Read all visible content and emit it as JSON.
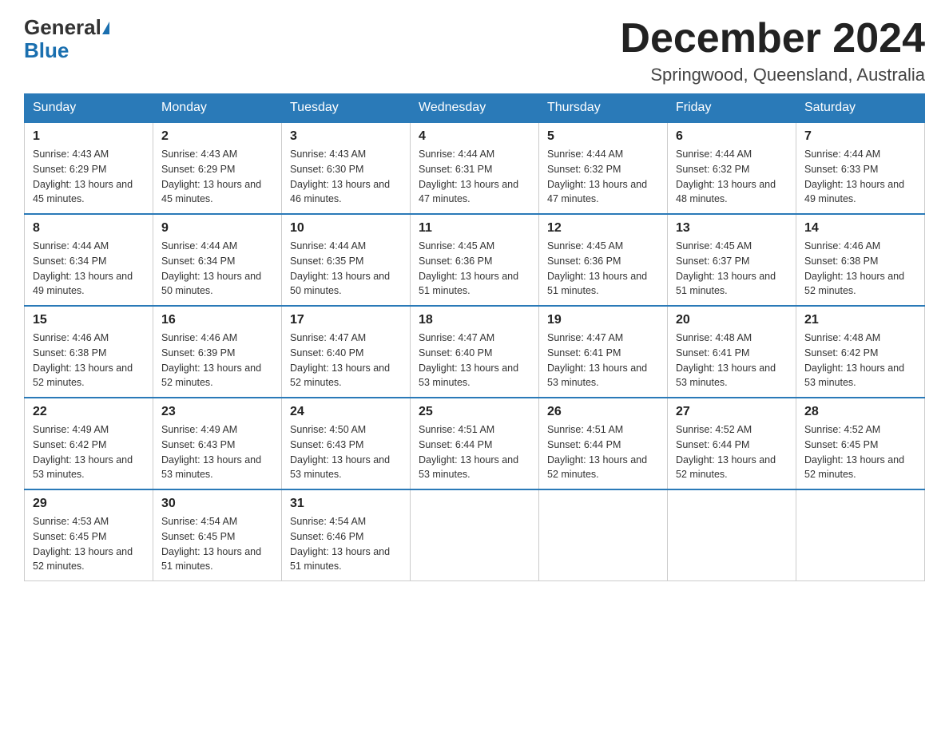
{
  "logo": {
    "line1": "General",
    "triangle": "▶",
    "line2": "Blue"
  },
  "title": "December 2024",
  "subtitle": "Springwood, Queensland, Australia",
  "days_of_week": [
    "Sunday",
    "Monday",
    "Tuesday",
    "Wednesday",
    "Thursday",
    "Friday",
    "Saturday"
  ],
  "weeks": [
    [
      {
        "day": "1",
        "sunrise": "4:43 AM",
        "sunset": "6:29 PM",
        "daylight": "13 hours and 45 minutes."
      },
      {
        "day": "2",
        "sunrise": "4:43 AM",
        "sunset": "6:29 PM",
        "daylight": "13 hours and 45 minutes."
      },
      {
        "day": "3",
        "sunrise": "4:43 AM",
        "sunset": "6:30 PM",
        "daylight": "13 hours and 46 minutes."
      },
      {
        "day": "4",
        "sunrise": "4:44 AM",
        "sunset": "6:31 PM",
        "daylight": "13 hours and 47 minutes."
      },
      {
        "day": "5",
        "sunrise": "4:44 AM",
        "sunset": "6:32 PM",
        "daylight": "13 hours and 47 minutes."
      },
      {
        "day": "6",
        "sunrise": "4:44 AM",
        "sunset": "6:32 PM",
        "daylight": "13 hours and 48 minutes."
      },
      {
        "day": "7",
        "sunrise": "4:44 AM",
        "sunset": "6:33 PM",
        "daylight": "13 hours and 49 minutes."
      }
    ],
    [
      {
        "day": "8",
        "sunrise": "4:44 AM",
        "sunset": "6:34 PM",
        "daylight": "13 hours and 49 minutes."
      },
      {
        "day": "9",
        "sunrise": "4:44 AM",
        "sunset": "6:34 PM",
        "daylight": "13 hours and 50 minutes."
      },
      {
        "day": "10",
        "sunrise": "4:44 AM",
        "sunset": "6:35 PM",
        "daylight": "13 hours and 50 minutes."
      },
      {
        "day": "11",
        "sunrise": "4:45 AM",
        "sunset": "6:36 PM",
        "daylight": "13 hours and 51 minutes."
      },
      {
        "day": "12",
        "sunrise": "4:45 AM",
        "sunset": "6:36 PM",
        "daylight": "13 hours and 51 minutes."
      },
      {
        "day": "13",
        "sunrise": "4:45 AM",
        "sunset": "6:37 PM",
        "daylight": "13 hours and 51 minutes."
      },
      {
        "day": "14",
        "sunrise": "4:46 AM",
        "sunset": "6:38 PM",
        "daylight": "13 hours and 52 minutes."
      }
    ],
    [
      {
        "day": "15",
        "sunrise": "4:46 AM",
        "sunset": "6:38 PM",
        "daylight": "13 hours and 52 minutes."
      },
      {
        "day": "16",
        "sunrise": "4:46 AM",
        "sunset": "6:39 PM",
        "daylight": "13 hours and 52 minutes."
      },
      {
        "day": "17",
        "sunrise": "4:47 AM",
        "sunset": "6:40 PM",
        "daylight": "13 hours and 52 minutes."
      },
      {
        "day": "18",
        "sunrise": "4:47 AM",
        "sunset": "6:40 PM",
        "daylight": "13 hours and 53 minutes."
      },
      {
        "day": "19",
        "sunrise": "4:47 AM",
        "sunset": "6:41 PM",
        "daylight": "13 hours and 53 minutes."
      },
      {
        "day": "20",
        "sunrise": "4:48 AM",
        "sunset": "6:41 PM",
        "daylight": "13 hours and 53 minutes."
      },
      {
        "day": "21",
        "sunrise": "4:48 AM",
        "sunset": "6:42 PM",
        "daylight": "13 hours and 53 minutes."
      }
    ],
    [
      {
        "day": "22",
        "sunrise": "4:49 AM",
        "sunset": "6:42 PM",
        "daylight": "13 hours and 53 minutes."
      },
      {
        "day": "23",
        "sunrise": "4:49 AM",
        "sunset": "6:43 PM",
        "daylight": "13 hours and 53 minutes."
      },
      {
        "day": "24",
        "sunrise": "4:50 AM",
        "sunset": "6:43 PM",
        "daylight": "13 hours and 53 minutes."
      },
      {
        "day": "25",
        "sunrise": "4:51 AM",
        "sunset": "6:44 PM",
        "daylight": "13 hours and 53 minutes."
      },
      {
        "day": "26",
        "sunrise": "4:51 AM",
        "sunset": "6:44 PM",
        "daylight": "13 hours and 52 minutes."
      },
      {
        "day": "27",
        "sunrise": "4:52 AM",
        "sunset": "6:44 PM",
        "daylight": "13 hours and 52 minutes."
      },
      {
        "day": "28",
        "sunrise": "4:52 AM",
        "sunset": "6:45 PM",
        "daylight": "13 hours and 52 minutes."
      }
    ],
    [
      {
        "day": "29",
        "sunrise": "4:53 AM",
        "sunset": "6:45 PM",
        "daylight": "13 hours and 52 minutes."
      },
      {
        "day": "30",
        "sunrise": "4:54 AM",
        "sunset": "6:45 PM",
        "daylight": "13 hours and 51 minutes."
      },
      {
        "day": "31",
        "sunrise": "4:54 AM",
        "sunset": "6:46 PM",
        "daylight": "13 hours and 51 minutes."
      },
      null,
      null,
      null,
      null
    ]
  ]
}
